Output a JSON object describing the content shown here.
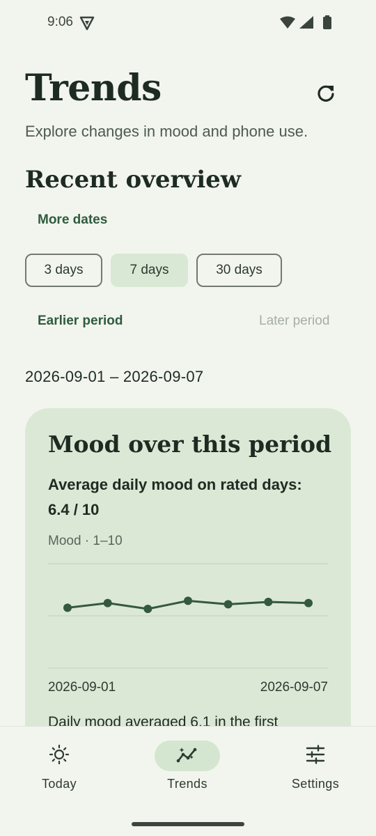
{
  "status_bar": {
    "time": "9:06"
  },
  "header": {
    "title": "Trends",
    "subtitle": "Explore changes in mood and phone use."
  },
  "overview": {
    "section_title": "Recent overview",
    "more_dates_label": "More dates",
    "ranges": [
      {
        "label": "3 days",
        "selected": false
      },
      {
        "label": "7 days",
        "selected": true
      },
      {
        "label": "30 days",
        "selected": false
      }
    ],
    "earlier_label": "Earlier period",
    "later_label": "Later period",
    "date_range": "2026-09-01 – 2026-09-07"
  },
  "mood_card": {
    "title": "Mood over this period",
    "average_text": "Average daily mood on rated days: 6.4 / 10",
    "axis_label": "Mood · 1–10",
    "x_start": "2026-09-01",
    "x_end": "2026-09-07",
    "summary": "Daily mood averaged 6.1 in the first"
  },
  "chart_data": {
    "type": "line",
    "x": [
      "2026-09-01",
      "2026-09-02",
      "2026-09-03",
      "2026-09-04",
      "2026-09-05",
      "2026-09-06",
      "2026-09-07"
    ],
    "values": [
      6.2,
      6.6,
      6.1,
      6.8,
      6.5,
      6.7,
      6.6
    ],
    "ylim": [
      1,
      10
    ],
    "ylabel": "Mood · 1–10",
    "grid": true,
    "line_color": "#33593f"
  },
  "nav": {
    "items": [
      {
        "label": "Today",
        "icon": "sun-icon",
        "active": false
      },
      {
        "label": "Trends",
        "icon": "trends-icon",
        "active": true
      },
      {
        "label": "Settings",
        "icon": "sliders-icon",
        "active": false
      }
    ]
  },
  "colors": {
    "background": "#f2f5ee",
    "card": "#dce8d6",
    "accent": "#2f5a3e",
    "selected_chip": "#d9e8d4"
  }
}
